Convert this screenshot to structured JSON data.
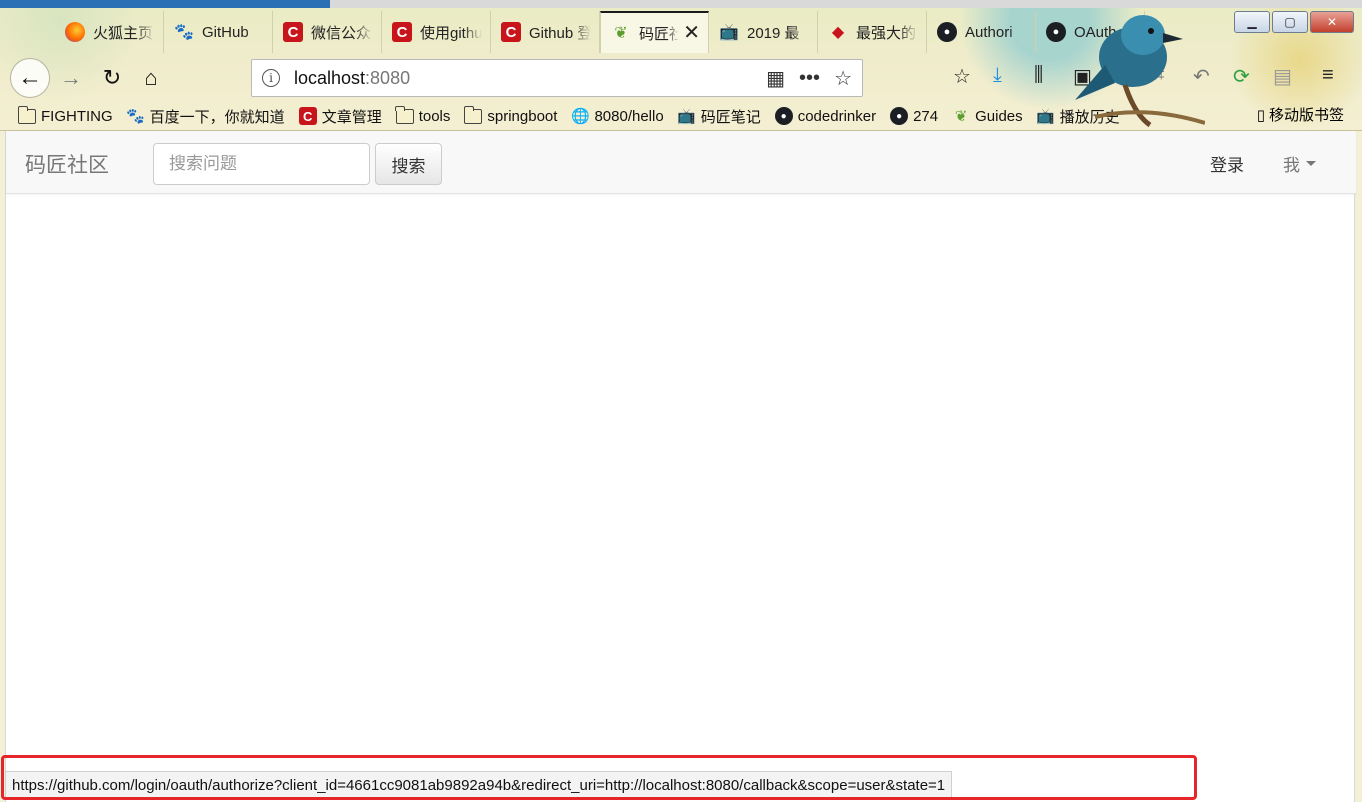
{
  "window": {
    "controls": {
      "minimize": "▁",
      "maximize": "▢",
      "close": "✕"
    }
  },
  "tabs": [
    {
      "title": "火狐主页",
      "icon": "firefox-icon"
    },
    {
      "title": "GitHub",
      "icon": "baidu-paw-icon"
    },
    {
      "title": "微信公众",
      "icon": "csdn-icon"
    },
    {
      "title": "使用github",
      "icon": "csdn-icon"
    },
    {
      "title": "Github 登",
      "icon": "csdn-icon"
    },
    {
      "title": "码匠社",
      "icon": "spring-leaf-icon",
      "active": true
    },
    {
      "title": "2019 最",
      "icon": "bilibili-icon"
    },
    {
      "title": "最强大的",
      "icon": "red-diamond-icon"
    },
    {
      "title": "Authori",
      "icon": "github-icon"
    },
    {
      "title": "OAuth",
      "icon": "github-icon"
    }
  ],
  "nav": {
    "url_host": "localhost",
    "url_port": ":8080"
  },
  "bookmarks": [
    {
      "label": "FIGHTING",
      "icon": "folder-icon"
    },
    {
      "label": "百度一下，你就知道",
      "icon": "baidu-paw-icon"
    },
    {
      "label": "文章管理",
      "icon": "csdn-icon"
    },
    {
      "label": "tools",
      "icon": "folder-icon"
    },
    {
      "label": "springboot",
      "icon": "folder-icon"
    },
    {
      "label": "8080/hello",
      "icon": "globe-icon"
    },
    {
      "label": "码匠笔记",
      "icon": "bilibili-icon"
    },
    {
      "label": "codedrinker",
      "icon": "github-icon"
    },
    {
      "label": "274",
      "icon": "github-icon"
    },
    {
      "label": "Guides",
      "icon": "spring-leaf-icon"
    },
    {
      "label": "播放历史",
      "icon": "bilibili-icon"
    }
  ],
  "mobile_bookmarks": "移动版书签",
  "site": {
    "brand": "码匠社区",
    "search_placeholder": "搜索问题",
    "search_button": "搜索",
    "login": "登录",
    "me": "我"
  },
  "status_url": "https://github.com/login/oauth/authorize?client_id=4661cc9081ab9892a94b&redirect_uri=http://localhost:8080/callback&scope=user&state=1",
  "colors": {
    "highlight": "#e5252a",
    "brand_text": "#777777"
  }
}
